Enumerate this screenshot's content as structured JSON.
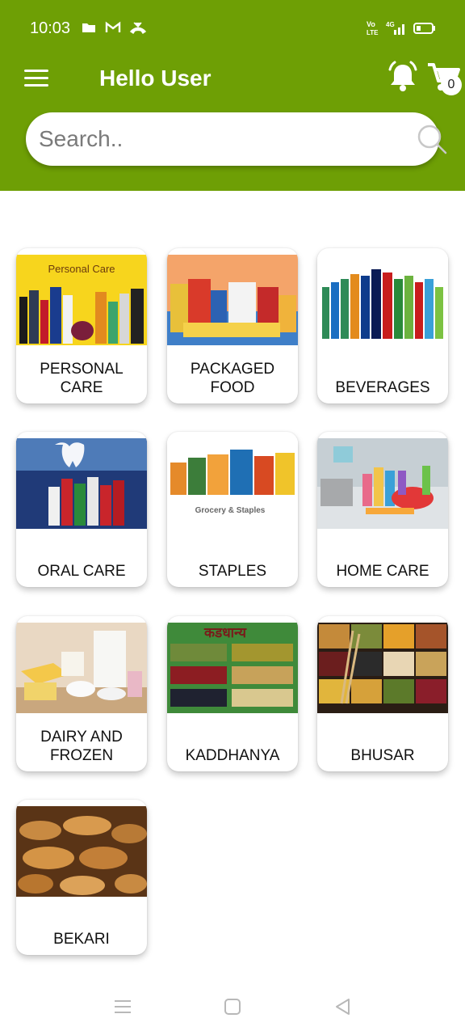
{
  "status_bar": {
    "time": "10:03",
    "icons_left": [
      "folder-icon",
      "gmail-icon",
      "missed-call-icon"
    ],
    "icons_right": [
      "volte-icon",
      "signal-4g-icon",
      "battery-icon"
    ],
    "volte_text": "Vo\nLTE",
    "network_text": "4G"
  },
  "header": {
    "greeting": "Hello User",
    "cart_count": "0",
    "background_color": "#6e9f05"
  },
  "search": {
    "placeholder": "Search.."
  },
  "categories": [
    {
      "label": "PERSONAL CARE",
      "banner_text": "Personal Care"
    },
    {
      "label": "PACKAGED FOOD"
    },
    {
      "label": "BEVERAGES"
    },
    {
      "label": "ORAL CARE"
    },
    {
      "label": "STAPLES",
      "banner_text": "Grocery & Staples"
    },
    {
      "label": "HOME CARE"
    },
    {
      "label": "DAIRY AND FROZEN"
    },
    {
      "label": "KADDHANYA",
      "banner_text": "कडधान्य"
    },
    {
      "label": "BHUSAR"
    },
    {
      "label": "BEKARI"
    }
  ],
  "nav": {
    "items": [
      "recent-apps-icon",
      "home-icon",
      "back-icon"
    ]
  }
}
